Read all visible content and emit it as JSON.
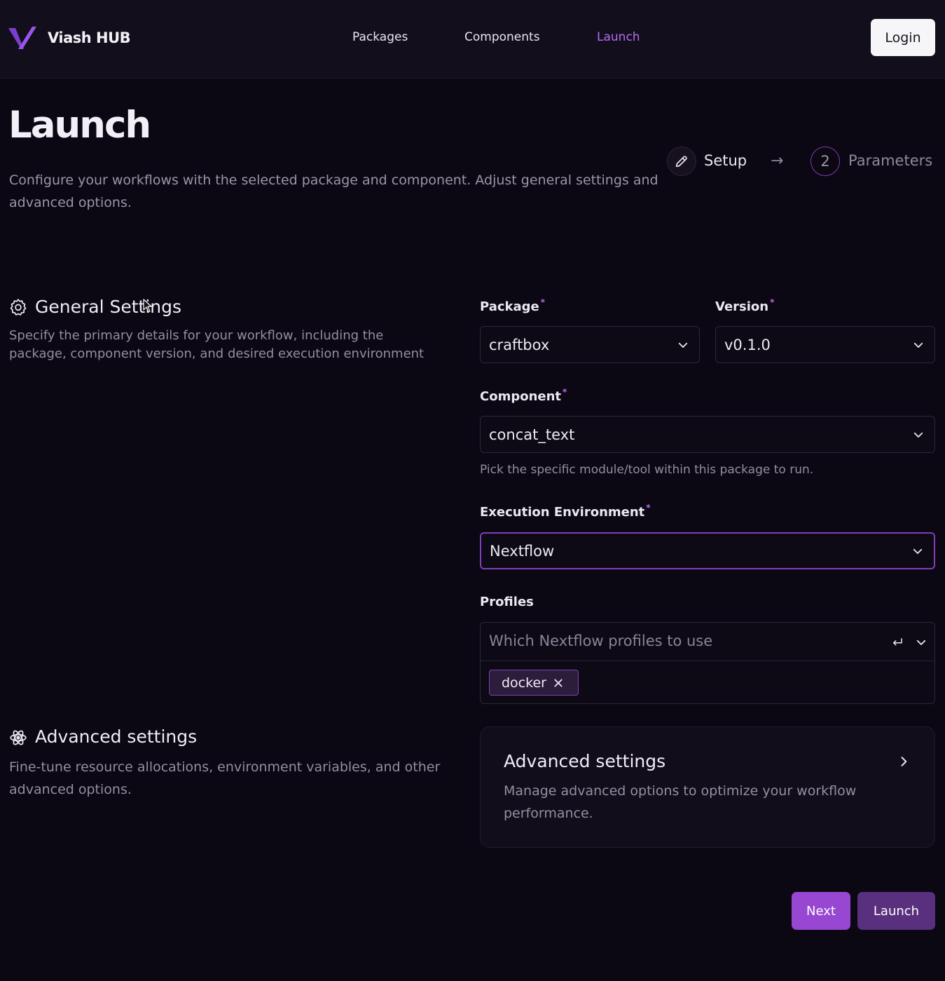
{
  "header": {
    "brand": "Viash HUB",
    "nav": [
      "Packages",
      "Components",
      "Launch"
    ],
    "active_nav": "Launch",
    "login_label": "Login"
  },
  "page": {
    "title": "Launch",
    "description": "Configure your workflows with the selected package and component. Adjust general settings and advanced options."
  },
  "stepper": {
    "step1_label": "Setup",
    "step2_number": "2",
    "step2_label": "Parameters"
  },
  "general": {
    "title": "General Settings",
    "description": "Specify the primary details for your workflow, including the package, component version, and desired execution environment"
  },
  "form": {
    "package_label": "Package",
    "package_value": "craftbox",
    "version_label": "Version",
    "version_value": "v0.1.0",
    "component_label": "Component",
    "component_value": "concat_text",
    "component_hint": "Pick the specific module/tool within this package to run.",
    "env_label": "Execution Environment",
    "env_value": "Nextflow",
    "profiles_label": "Profiles",
    "profiles_placeholder": "Which Nextflow profiles to use",
    "profiles_tags": [
      "docker"
    ],
    "required_mark": "*"
  },
  "advanced": {
    "title": "Advanced settings",
    "description": "Fine-tune resource allocations, environment variables, and other advanced options.",
    "card_title": "Advanced settings",
    "card_description": "Manage advanced options to optimize your workflow performance."
  },
  "actions": {
    "next_label": "Next",
    "launch_label": "Launch"
  },
  "colors": {
    "accent": "#b66bf2",
    "background": "#0b0713",
    "next_button": "#9747d1",
    "launch_button": "#59307e"
  },
  "icons": [
    "viash-logo-icon",
    "pencil-icon",
    "arrow-right-icon",
    "gear-icon",
    "chevron-down-icon",
    "enter-icon",
    "close-icon",
    "atom-icon",
    "chevron-right-icon"
  ]
}
